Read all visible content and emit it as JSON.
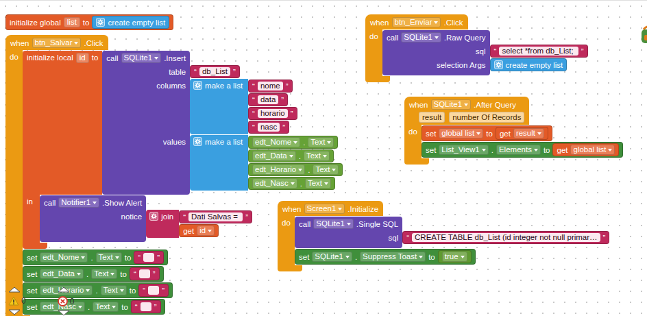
{
  "quotes": {
    "open": "“",
    "close": "”"
  },
  "blocks": [
    {
      "kind": "init-global",
      "label": "initialize global",
      "name": "list",
      "to": "to",
      "value": {
        "kind": "empty-list",
        "label": "create empty list"
      }
    },
    {
      "kind": "event",
      "when": "when",
      "component": "btn_Salvar",
      "event": ".Click",
      "params": [],
      "do": "do",
      "body": [
        {
          "kind": "init-local",
          "label": "initialize local",
          "name": "id",
          "to": "to",
          "value": {
            "kind": "call",
            "call": "call",
            "component": "SQLite1",
            "method": ".Insert",
            "args": [
              {
                "name": "table",
                "value": {
                  "kind": "text",
                  "value": "db_List"
                }
              },
              {
                "name": "columns",
                "value": {
                  "kind": "make-list",
                  "label": "make a list",
                  "items": [
                    {
                      "kind": "text",
                      "value": "nome"
                    },
                    {
                      "kind": "text",
                      "value": "data"
                    },
                    {
                      "kind": "text",
                      "value": "horario"
                    },
                    {
                      "kind": "text",
                      "value": "nasc"
                    }
                  ]
                }
              },
              {
                "name": "values",
                "value": {
                  "kind": "make-list",
                  "label": "make a list",
                  "items": [
                    {
                      "kind": "get-prop",
                      "component": "edt_Nome",
                      "sep": ".",
                      "prop": "Text"
                    },
                    {
                      "kind": "get-prop",
                      "component": "edt_Data",
                      "sep": ".",
                      "prop": "Text"
                    },
                    {
                      "kind": "get-prop",
                      "component": "edt_Horario",
                      "sep": ".",
                      "prop": "Text"
                    },
                    {
                      "kind": "get-prop",
                      "component": "edt_Nasc",
                      "sep": ".",
                      "prop": "Text"
                    }
                  ]
                }
              }
            ]
          },
          "in": "in",
          "body": [
            {
              "kind": "call",
              "call": "call",
              "component": "Notifier1",
              "method": ".Show Alert",
              "args": [
                {
                  "name": "notice",
                  "value": {
                    "kind": "join",
                    "label": "join",
                    "items": [
                      {
                        "kind": "text",
                        "value": "Dati Salvas = "
                      },
                      {
                        "kind": "get",
                        "get": "get",
                        "name": "id"
                      }
                    ]
                  }
                }
              ]
            }
          ]
        },
        {
          "kind": "set",
          "set": "set",
          "component": "edt_Nome",
          "sep": ".",
          "prop": "Text",
          "to": "to",
          "value": {
            "kind": "text",
            "value": ""
          }
        },
        {
          "kind": "set",
          "set": "set",
          "component": "edt_Data",
          "sep": ".",
          "prop": "Text",
          "to": "to",
          "value": {
            "kind": "text",
            "value": ""
          }
        },
        {
          "kind": "set",
          "set": "set",
          "component": "edt_Horario",
          "sep": ".",
          "prop": "Text",
          "to": "to",
          "value": {
            "kind": "text",
            "value": ""
          }
        },
        {
          "kind": "set",
          "set": "set",
          "component": "edt_Nasc",
          "sep": ".",
          "prop": "Text",
          "to": "to",
          "value": {
            "kind": "text",
            "value": ""
          }
        }
      ]
    },
    {
      "kind": "event",
      "when": "when",
      "component": "btn_Enviar",
      "event": ".Click",
      "params": [],
      "do": "do",
      "body": [
        {
          "kind": "call",
          "call": "call",
          "component": "SQLite1",
          "method": ".Raw Query",
          "args": [
            {
              "name": "sql",
              "value": {
                "kind": "text",
                "value": "select *from db_List; "
              }
            },
            {
              "name": "selection Args",
              "value": {
                "kind": "empty-list",
                "label": "create empty list"
              }
            }
          ]
        }
      ]
    },
    {
      "kind": "event",
      "when": "when",
      "component": "SQLite1",
      "event": ".After Query",
      "params": [
        "result",
        "number Of Records"
      ],
      "do": "do",
      "body": [
        {
          "kind": "set-var",
          "set": "set",
          "name": "global list",
          "to": "to",
          "value": {
            "kind": "get",
            "get": "get",
            "name": "result"
          }
        },
        {
          "kind": "set",
          "set": "set",
          "component": "List_View1",
          "sep": ".",
          "prop": "Elements",
          "to": "to",
          "value": {
            "kind": "get",
            "get": "get",
            "name": "global list"
          }
        }
      ]
    },
    {
      "kind": "event",
      "when": "when",
      "component": "Screen1",
      "event": ".Initialize",
      "params": [],
      "do": "do",
      "body": [
        {
          "kind": "call",
          "call": "call",
          "component": "SQLite1",
          "method": ".Single SQL",
          "args": [
            {
              "name": "sql",
              "value": {
                "kind": "text",
                "value": "CREATE TABLE db_List (id integer not null primar…"
              }
            }
          ]
        },
        {
          "kind": "set",
          "set": "set",
          "component": "SQLite1",
          "sep": ".",
          "prop": "Suppress Toast",
          "to": "to",
          "value": {
            "kind": "bool",
            "value": "true"
          }
        }
      ]
    }
  ],
  "status": {
    "warnings": "0",
    "errors": "0"
  }
}
